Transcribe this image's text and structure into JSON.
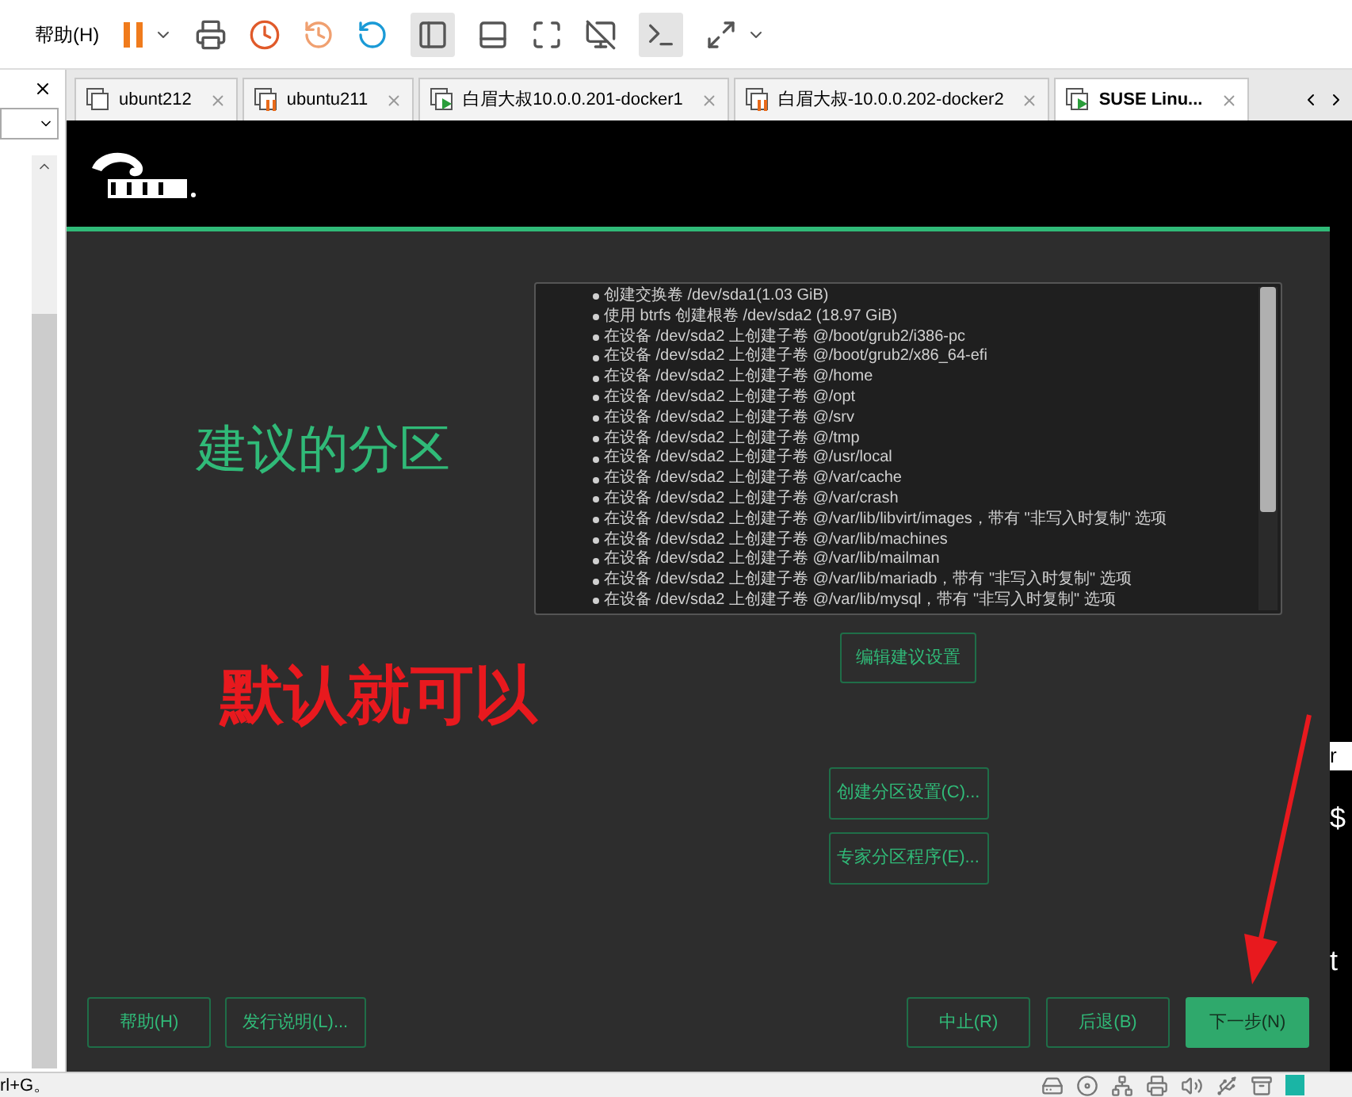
{
  "menu": {
    "label": "帮助(H)"
  },
  "vm_tabs": [
    {
      "label": "ubunt212",
      "kind": "stopped",
      "selected": false
    },
    {
      "label": "ubuntu211",
      "kind": "paused",
      "selected": false
    },
    {
      "label": "白眉大叔10.0.0.201-docker1",
      "kind": "running",
      "selected": false
    },
    {
      "label": "白眉大叔-10.0.0.202-docker2",
      "kind": "paused",
      "selected": false
    },
    {
      "label": "SUSE Linu...",
      "kind": "running",
      "selected": true
    }
  ],
  "installer": {
    "heading": "建议的分区",
    "proposal_items": [
      "创建交换卷 /dev/sda1(1.03 GiB)",
      "使用 btrfs 创建根卷 /dev/sda2 (18.97 GiB)",
      "在设备 /dev/sda2 上创建子卷 @/boot/grub2/i386-pc",
      "在设备 /dev/sda2 上创建子卷 @/boot/grub2/x86_64-efi",
      "在设备 /dev/sda2 上创建子卷 @/home",
      "在设备 /dev/sda2 上创建子卷 @/opt",
      "在设备 /dev/sda2 上创建子卷 @/srv",
      "在设备 /dev/sda2 上创建子卷 @/tmp",
      "在设备 /dev/sda2 上创建子卷 @/usr/local",
      "在设备 /dev/sda2 上创建子卷 @/var/cache",
      "在设备 /dev/sda2 上创建子卷 @/var/crash",
      "在设备 /dev/sda2 上创建子卷 @/var/lib/libvirt/images，带有 \"非写入时复制\" 选项",
      "在设备 /dev/sda2 上创建子卷 @/var/lib/machines",
      "在设备 /dev/sda2 上创建子卷 @/var/lib/mailman",
      "在设备 /dev/sda2 上创建子卷 @/var/lib/mariadb，带有 \"非写入时复制\" 选项",
      "在设备 /dev/sda2 上创建子卷 @/var/lib/mysql，带有 \"非写入时复制\" 选项"
    ],
    "edit_button": "编辑建议设置",
    "setup_buttons": [
      "创建分区设置(C)...",
      "专家分区程序(E)..."
    ],
    "footer_left": [
      "帮助(H)",
      "发行说明(L)..."
    ],
    "footer_right": [
      {
        "label": "中止(R)",
        "kind": "secondary"
      },
      {
        "label": "后退(B)",
        "kind": "secondary"
      },
      {
        "label": "下一步(N)",
        "kind": "primary"
      }
    ]
  },
  "annotation": {
    "text": "默认就可以"
  },
  "right_edge": [
    "r",
    "$",
    "t"
  ],
  "status_bar": {
    "text": "rl+G。"
  }
}
